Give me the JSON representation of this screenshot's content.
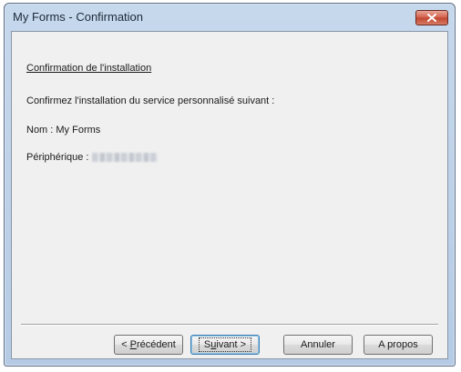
{
  "window": {
    "title": "My Forms - Confirmation"
  },
  "content": {
    "heading": "Confirmation de l'installation",
    "instruction": "Confirmez l'installation du service personnalisé suivant :",
    "name_line": "Nom : My Forms",
    "device_label": "Périphérique :"
  },
  "buttons": {
    "back_prefix": "< ",
    "back_accel": "P",
    "back_rest": "récédent",
    "next_prefix": "S",
    "next_accel": "u",
    "next_rest": "ivant >",
    "cancel": "Annuler",
    "about": "A propos"
  },
  "icons": {
    "close": "close-icon"
  },
  "colors": {
    "titlebar": "#b5cbe5",
    "close_button": "#d15e48",
    "client_background": "#f0f0f0",
    "default_button_border": "#3c7fb1"
  }
}
